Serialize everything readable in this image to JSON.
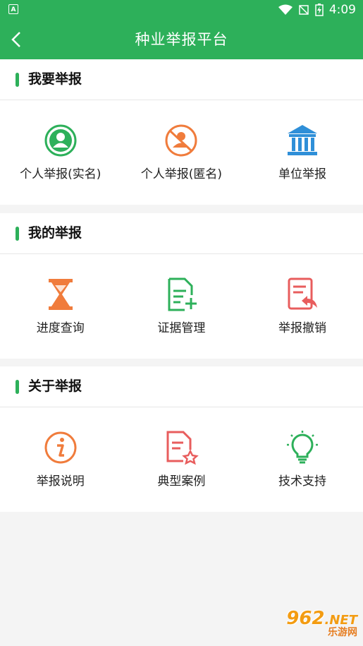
{
  "status_bar": {
    "time": "4:09"
  },
  "app_bar": {
    "title": "种业举报平台"
  },
  "sections": [
    {
      "title": "我要举报",
      "items": [
        {
          "label": "个人举报(实名)",
          "icon": "person-circle-icon"
        },
        {
          "label": "个人举报(匿名)",
          "icon": "anonymous-person-icon"
        },
        {
          "label": "单位举报",
          "icon": "building-icon"
        }
      ]
    },
    {
      "title": "我的举报",
      "items": [
        {
          "label": "进度查询",
          "icon": "hourglass-icon"
        },
        {
          "label": "证据管理",
          "icon": "document-add-icon"
        },
        {
          "label": "举报撤销",
          "icon": "document-undo-icon"
        }
      ]
    },
    {
      "title": "关于举报",
      "items": [
        {
          "label": "举报说明",
          "icon": "info-icon"
        },
        {
          "label": "典型案例",
          "icon": "document-star-icon"
        },
        {
          "label": "技术支持",
          "icon": "lightbulb-icon"
        }
      ]
    }
  ],
  "watermark": {
    "main": "962",
    "suffix": ".NET",
    "sub": "乐游网"
  },
  "colors": {
    "primary": "#2db05a",
    "orange": "#f07c3c",
    "red": "#e85d5d",
    "blue": "#2f8fd8"
  }
}
